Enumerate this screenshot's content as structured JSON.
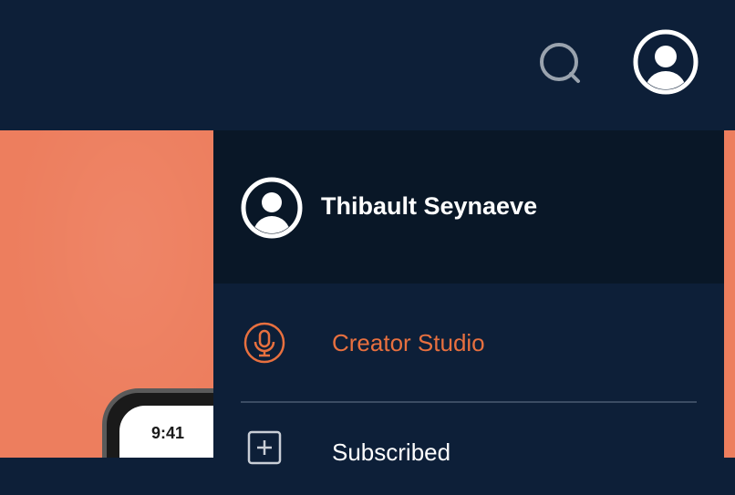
{
  "header": {
    "search_icon": "search-icon",
    "account_icon": "user-avatar-icon"
  },
  "hero": {
    "phone_time": "9:41",
    "background_color": "#ed7e5e"
  },
  "menu": {
    "profile": {
      "name": "Thibault Seynaeve",
      "avatar_icon": "user-avatar-icon"
    },
    "items": [
      {
        "label": "Creator Studio",
        "icon": "microphone-icon",
        "color": "#e8703f"
      },
      {
        "label": "Subscribed",
        "icon": "plus-square-icon",
        "color": "#ffffff"
      }
    ]
  },
  "colors": {
    "nav_bg": "#0d1f38",
    "profile_bg": "#091727",
    "accent": "#e8703f"
  }
}
